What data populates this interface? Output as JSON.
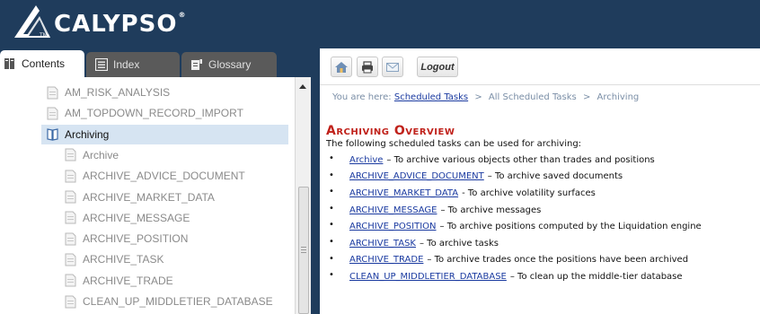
{
  "brand": {
    "name": "CALYPSO",
    "reg": "®",
    "tm": "TM"
  },
  "tabs": [
    {
      "label": "Contents",
      "icon": "book-icon",
      "active": true
    },
    {
      "label": "Index",
      "icon": "list-icon",
      "active": false
    },
    {
      "label": "Glossary",
      "icon": "glossary-icon",
      "active": false
    }
  ],
  "toc": {
    "items": [
      {
        "label": "AM_RISK_ANALYSIS",
        "kind": "page",
        "indent": 1
      },
      {
        "label": "AM_TOPDOWN_RECORD_IMPORT",
        "kind": "page",
        "indent": 1
      },
      {
        "label": "Archiving",
        "kind": "book",
        "indent": 1,
        "selected": true
      },
      {
        "label": "Archive",
        "kind": "page",
        "indent": 2
      },
      {
        "label": "ARCHIVE_ADVICE_DOCUMENT",
        "kind": "page",
        "indent": 2
      },
      {
        "label": "ARCHIVE_MARKET_DATA",
        "kind": "page",
        "indent": 2
      },
      {
        "label": "ARCHIVE_MESSAGE",
        "kind": "page",
        "indent": 2
      },
      {
        "label": "ARCHIVE_POSITION",
        "kind": "page",
        "indent": 2
      },
      {
        "label": "ARCHIVE_TASK",
        "kind": "page",
        "indent": 2
      },
      {
        "label": "ARCHIVE_TRADE",
        "kind": "page",
        "indent": 2
      },
      {
        "label": "CLEAN_UP_MIDDLETIER_DATABASE",
        "kind": "page",
        "indent": 2
      }
    ]
  },
  "toolbar": {
    "logout_label": "Logout"
  },
  "breadcrumb": {
    "prefix": "You are here:",
    "link": "Scheduled Tasks",
    "sep": ">",
    "crumbs": [
      "All Scheduled Tasks",
      "Archiving"
    ]
  },
  "page": {
    "title": "Archiving Overview",
    "intro": "The following scheduled tasks can be used for archiving:",
    "tasks": [
      {
        "name": "Archive",
        "desc": "– To archive various objects other than trades and positions"
      },
      {
        "name": "ARCHIVE_ADVICE_DOCUMENT",
        "desc": "– To archive saved documents"
      },
      {
        "name": "ARCHIVE_MARKET_DATA",
        "desc": "- To archive volatility surfaces"
      },
      {
        "name": "ARCHIVE_MESSAGE",
        "desc": "– To archive messages"
      },
      {
        "name": "ARCHIVE_POSITION",
        "desc": "– To archive positions computed by the Liquidation engine"
      },
      {
        "name": "ARCHIVE_TASK",
        "desc": "– To archive tasks"
      },
      {
        "name": "ARCHIVE_TRADE",
        "desc": "– To archive trades once the positions have been archived"
      },
      {
        "name": "CLEAN_UP_MIDDLETIER_DATABASE",
        "desc": "– To clean up the middle-tier database"
      }
    ]
  },
  "colors": {
    "header_bg": "#1f3c5c",
    "title_red": "#c0221b",
    "link_blue": "#1a3aa0",
    "selected_bg": "#d6e4f2"
  }
}
